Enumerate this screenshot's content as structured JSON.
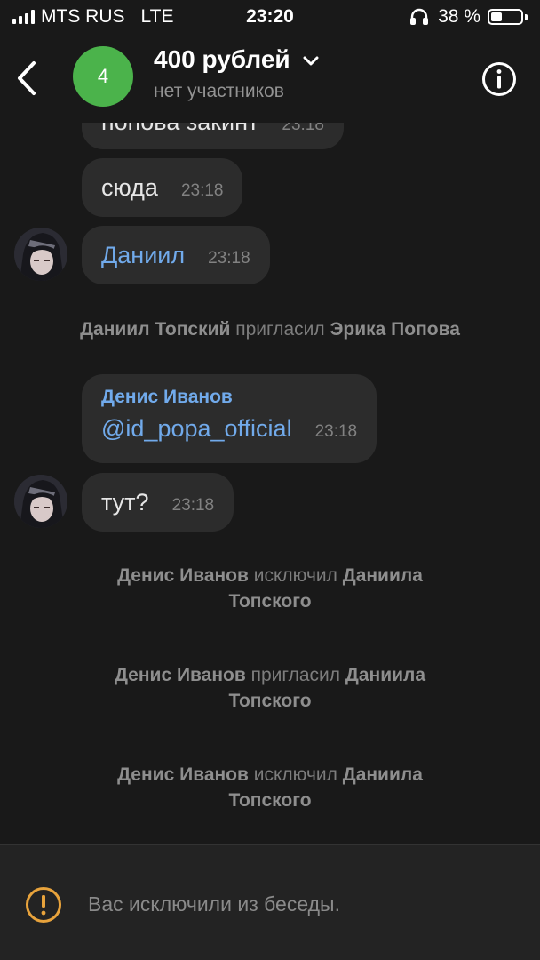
{
  "status_bar": {
    "carrier": "MTS RUS",
    "network": "LTE",
    "time": "23:20",
    "battery": "38 %",
    "battery_level": 0.38
  },
  "header": {
    "avatar_number": "4",
    "title": "400 рублей",
    "subtitle": "нет участников",
    "avatar_color": "#4bb34b"
  },
  "messages": [
    {
      "text": "попова закинт",
      "time": "23:18"
    },
    {
      "text": "сюда",
      "time": "23:18"
    },
    {
      "text": "Даниил",
      "time": "23:18"
    },
    {
      "sender": "Денис Иванов",
      "text": "@id_popa_official",
      "time": "23:18"
    },
    {
      "text": "тут?",
      "time": "23:18"
    }
  ],
  "service_messages": [
    {
      "actor": "Даниил Топский",
      "action": " пригласил ",
      "target": "Эрика Попова"
    },
    {
      "actor": "Денис Иванов",
      "action": " исключил ",
      "target": "Даниила",
      "target2": "Топского"
    },
    {
      "actor": "Денис Иванов",
      "action": " пригласил ",
      "target": "Даниила",
      "target2": "Топского"
    },
    {
      "actor": "Денис Иванов",
      "action": " исключил ",
      "target": "Даниила",
      "target2": "Топского"
    }
  ],
  "footer": {
    "notice": "Вас исключили из беседы.",
    "accent": "#e8a33c"
  },
  "icons": [
    "back-arrow-icon",
    "chevron-down-icon",
    "info-icon",
    "warning-icon",
    "headphones-icon",
    "signal-icon",
    "battery-icon"
  ]
}
